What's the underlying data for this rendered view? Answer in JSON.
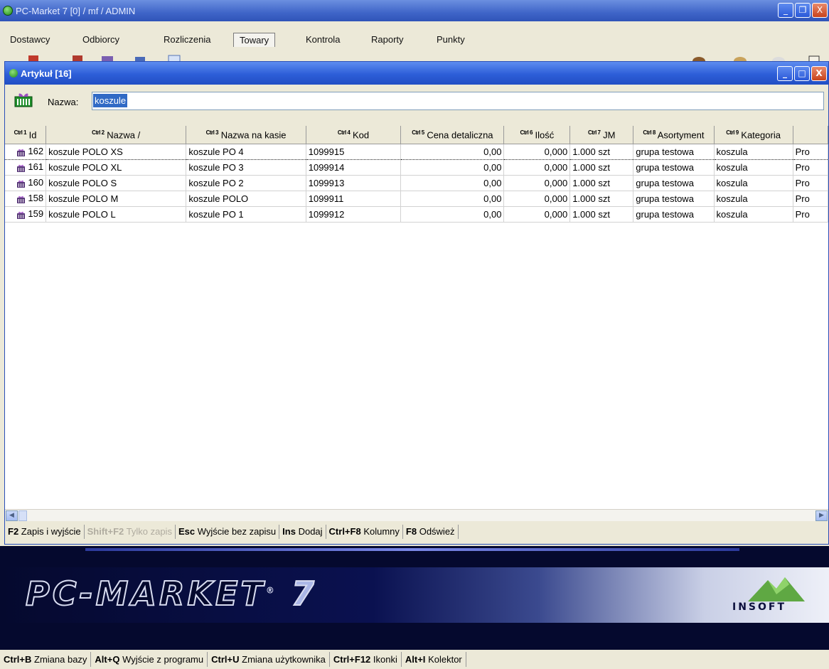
{
  "app": {
    "title": "PC-Market 7 [0] / mf / ADMIN",
    "window_buttons": {
      "minimize": "_",
      "maximize": "❐",
      "close": "X"
    }
  },
  "menu": [
    {
      "label": "Dostawcy"
    },
    {
      "label": "Odbiorcy"
    },
    {
      "label": "Rozliczenia"
    },
    {
      "label": "Towary"
    },
    {
      "label": "Kontrola"
    },
    {
      "label": "Raporty"
    },
    {
      "label": "Punkty"
    }
  ],
  "child_window": {
    "title": "Artykuł [16]",
    "window_buttons": {
      "minimize": "_",
      "maximize": "□",
      "close": "X"
    }
  },
  "search": {
    "label": "Nazwa:",
    "value": "koszule"
  },
  "columns": [
    {
      "ctrl": "Ctrl 1",
      "label": "Id"
    },
    {
      "ctrl": "Ctrl 2",
      "label": "Nazwa  /"
    },
    {
      "ctrl": "Ctrl 3",
      "label": "Nazwa na kasie"
    },
    {
      "ctrl": "Ctrl 4",
      "label": "Kod"
    },
    {
      "ctrl": "Ctrl 5",
      "label": "Cena detaliczna"
    },
    {
      "ctrl": "Ctrl 6",
      "label": "Ilość"
    },
    {
      "ctrl": "Ctrl 7",
      "label": "JM"
    },
    {
      "ctrl": "Ctrl 8",
      "label": "Asortyment"
    },
    {
      "ctrl": "Ctrl 9",
      "label": "Kategoria"
    },
    {
      "ctrl": "",
      "label": ""
    }
  ],
  "rows": [
    {
      "id": "162",
      "nazwa": "koszule POLO XS",
      "kasa": "koszule PO 4",
      "kod": "1099915",
      "cena": "0,00",
      "ilosc": "0,000",
      "jm": "1.000 szt",
      "asortyment": "grupa testowa",
      "kategoria": "koszula",
      "extra": "Pro"
    },
    {
      "id": "161",
      "nazwa": "koszule POLO XL",
      "kasa": "koszule PO 3",
      "kod": "1099914",
      "cena": "0,00",
      "ilosc": "0,000",
      "jm": "1.000 szt",
      "asortyment": "grupa testowa",
      "kategoria": "koszula",
      "extra": "Pro"
    },
    {
      "id": "160",
      "nazwa": "koszule POLO S",
      "kasa": "koszule PO 2",
      "kod": "1099913",
      "cena": "0,00",
      "ilosc": "0,000",
      "jm": "1.000 szt",
      "asortyment": "grupa testowa",
      "kategoria": "koszula",
      "extra": "Pro"
    },
    {
      "id": "158",
      "nazwa": "koszule POLO M",
      "kasa": "koszule POLO",
      "kod": "1099911",
      "cena": "0,00",
      "ilosc": "0,000",
      "jm": "1.000 szt",
      "asortyment": "grupa testowa",
      "kategoria": "koszula",
      "extra": "Pro"
    },
    {
      "id": "159",
      "nazwa": "koszule POLO L",
      "kasa": "koszule PO 1",
      "kod": "1099912",
      "cena": "0,00",
      "ilosc": "0,000",
      "jm": "1.000 szt",
      "asortyment": "grupa testowa",
      "kategoria": "koszula",
      "extra": "Pro"
    }
  ],
  "function_bar": [
    {
      "key": "F2",
      "label": "Zapis i wyjście",
      "disabled": false
    },
    {
      "key": "Shift+F2",
      "label": "Tylko zapis",
      "disabled": true
    },
    {
      "key": "Esc",
      "label": "Wyjście bez zapisu",
      "disabled": false
    },
    {
      "key": "Ins",
      "label": "Dodaj",
      "disabled": false
    },
    {
      "key": "Ctrl+F8",
      "label": "Kolumny",
      "disabled": false
    },
    {
      "key": "F8",
      "label": "Odśwież",
      "disabled": false
    }
  ],
  "banner": {
    "brand": "PC-MARKET",
    "registered": "®",
    "version": "7",
    "vendor": "INSOFT"
  },
  "bottom_bar": [
    {
      "key": "Ctrl+B",
      "label": "Zmiana bazy"
    },
    {
      "key": "Alt+Q",
      "label": "Wyjście z programu"
    },
    {
      "key": "Ctrl+U",
      "label": "Zmiana użytkownika"
    },
    {
      "key": "Ctrl+F12",
      "label": "Ikonki"
    },
    {
      "key": "Alt+I",
      "label": "Kolektor"
    }
  ],
  "colors": {
    "titlebar": "#3f65c8",
    "child_titlebar": "#2d5ed8",
    "window_bg": "#ece9d8",
    "selection": "#316ac5",
    "banner_bg": "#05092e"
  }
}
